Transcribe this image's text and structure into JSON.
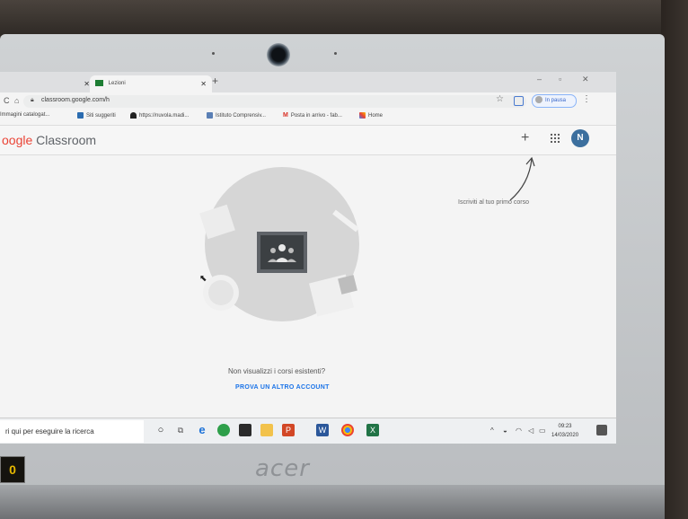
{
  "browser": {
    "tabs": [
      {
        "label": ""
      },
      {
        "label": "Lezioni"
      }
    ],
    "url": "classroom.google.com/h",
    "profile_label": "In pausa",
    "bookmarks": [
      {
        "label": "Immagini catalogat..."
      },
      {
        "label": "Siti suggeriti"
      },
      {
        "label": "https://nuvola.madi..."
      },
      {
        "label": "Istituto Comprensiv..."
      },
      {
        "label": "Posta in arrivo - fab..."
      },
      {
        "label": "Home"
      }
    ]
  },
  "app": {
    "logo_prefix": "oogle",
    "logo_suffix": "Classroom",
    "add_symbol": "+",
    "avatar_initial": "N",
    "hint": "Iscriviti al tuo primo corso",
    "question": "Non visualizzi i corsi esistenti?",
    "link": "PROVA UN ALTRO ACCOUNT"
  },
  "taskbar": {
    "search_text": "ri qui per eseguire la ricerca",
    "time": "09:23",
    "date": "14/03/2020"
  },
  "laptop": {
    "brand": "acer",
    "badge": "0"
  }
}
